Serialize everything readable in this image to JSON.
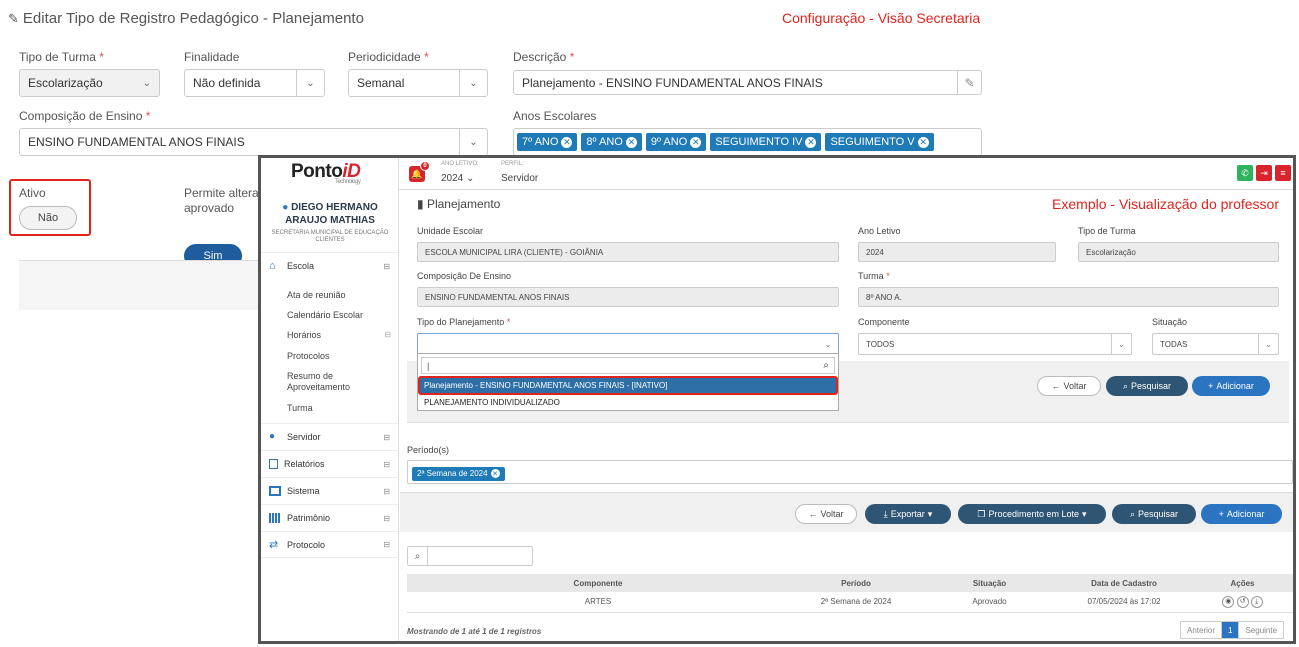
{
  "bg": {
    "title": "Editar Tipo de Registro Pedagógico - Planejamento",
    "annotation": "Configuração - Visão Secretaria",
    "fields": {
      "tipo_turma": {
        "label": "Tipo de Turma",
        "value": "Escolarização"
      },
      "finalidade": {
        "label": "Finalidade",
        "value": "Não definida"
      },
      "periodicidade": {
        "label": "Periodicidade",
        "value": "Semanal"
      },
      "descricao": {
        "label": "Descrição",
        "value": "Planejamento - ENSINO FUNDAMENTAL ANOS FINAIS"
      },
      "composicao": {
        "label": "Composição de Ensino",
        "value": "ENSINO FUNDAMENTAL ANOS FINAIS"
      },
      "anos": {
        "label": "Anos Escolares",
        "tags": [
          "7º ANO",
          "8º ANO",
          "9º ANO",
          "SEGUIMENTO IV",
          "SEGUIMENTO V"
        ]
      }
    },
    "ativo": {
      "label": "Ativo",
      "value": "Não"
    },
    "permite": {
      "label_1": "Permite alterar",
      "label_2": "aprovado",
      "value": "Sim"
    }
  },
  "app": {
    "logo": "Ponto",
    "logo_accent": "iD",
    "logo_sub": "Technology",
    "notif_count": "0",
    "ano_letivo_label": "ANO LETIVO:",
    "ano_letivo_value": "2024",
    "perfil_label": "PERFIL:",
    "perfil_value": "Servidor",
    "user_name": "DIEGO HERMANO ARAUJO MATHIAS",
    "user_org": "SECRETARIA MUNICIPAL DE EDUCAÇÃO CLIENTES",
    "menu": {
      "escola": "Escola",
      "escola_items": [
        "Ata de reunião",
        "Calendário Escolar",
        "Horários",
        "Protocolos",
        "Resumo de",
        "Aproveitamento",
        "Turma"
      ],
      "servidor": "Servidor",
      "relatorios": "Relatórios",
      "sistema": "Sistema",
      "patrimonio": "Patrimônio",
      "protocolo": "Protocolo"
    },
    "page_title": "Planejamento",
    "annotation": "Exemplo - Visualização do professor",
    "form": {
      "unidade": {
        "label": "Unidade Escolar",
        "value": "ESCOLA MUNICIPAL LIRA (CLIENTE) - GOIÂNIA"
      },
      "ano": {
        "label": "Ano Letivo",
        "value": "2024"
      },
      "tipo_turma": {
        "label": "Tipo de Turma",
        "value": "Escolarização"
      },
      "composicao": {
        "label": "Composição De Ensino",
        "value": "ENSINO FUNDAMENTAL ANOS FINAIS"
      },
      "turma": {
        "label": "Turma",
        "value": "8º ANO A."
      },
      "tipo_plan": {
        "label": "Tipo do Planejamento",
        "value": ""
      },
      "componente": {
        "label": "Componente",
        "value": "TODOS"
      },
      "situacao": {
        "label": "Situação",
        "value": "TODAS"
      }
    },
    "dropdown": {
      "search": "|",
      "options": [
        "Planejamento - ENSINO FUNDAMENTAL ANOS FINAIS - [INATIVO]",
        "PLANEJAMENTO INDIVIDUALIZADO"
      ]
    },
    "buttons": {
      "voltar": "Voltar",
      "pesquisar": "Pesquisar",
      "adicionar": "Adicionar",
      "exportar": "Exportar",
      "lote": "Procedimento em Lote"
    },
    "periodos_label": "Período(s)",
    "periodo_tag": "2ª Semana de 2024",
    "table": {
      "headers": [
        "Componente",
        "Período",
        "Situação",
        "Data de Cadastro",
        "Ações"
      ],
      "rows": [
        [
          "ARTES",
          "2ª Semana de 2024",
          "Aprovado",
          "07/05/2024 às 17:02"
        ]
      ]
    },
    "footer": "Mostrando de 1 até 1 de 1 registros",
    "pager": {
      "prev": "Anterior",
      "page": "1",
      "next": "Seguinte"
    }
  }
}
